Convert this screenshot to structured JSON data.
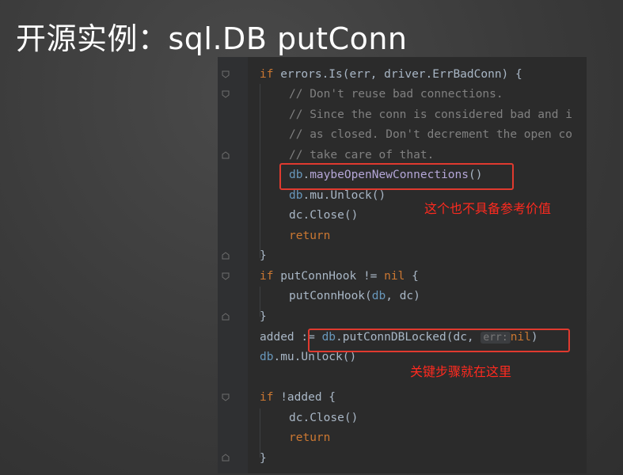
{
  "slide": {
    "title": "开源实例：sql.DB putConn"
  },
  "annotations": {
    "first": "这个也不具备参考价值",
    "second": "关键步骤就在这里"
  },
  "code": {
    "l1": {
      "kw": "if",
      "a": " errors.Is(err, driver.ErrBadConn) {"
    },
    "l2": "// Don't reuse bad connections.",
    "l3": "// Since the conn is considered bad and i",
    "l4": "// as closed. Don't decrement the open co",
    "l5": "// take care of that.",
    "l6": {
      "obj": "db",
      "dot": ".",
      "call": "maybeOpenNewConnections",
      "end": "()"
    },
    "l7": {
      "obj": "db",
      "rest": ".mu.",
      "call": "Unlock",
      "end": "()"
    },
    "l8": {
      "obj": "dc.",
      "call": "Close",
      "end": "()"
    },
    "l9": "return",
    "l10": "}",
    "l11": {
      "kw": "if",
      "a": " putConnHook != ",
      "nil": "nil",
      "b": " {"
    },
    "l12": {
      "a": "putConnHook(",
      "obj": "db",
      "b": ", dc)"
    },
    "l13": "}",
    "l14": {
      "a": "added := ",
      "obj": "db",
      "dot": ".",
      "call": "putConnDBLocked",
      "b": "(dc, ",
      "hint": "err:",
      "nil": "nil",
      "end": ")"
    },
    "l15": {
      "obj": "db",
      "rest": ".mu.",
      "call": "Unlock",
      "end": "()"
    },
    "l17": {
      "kw": "if",
      "a": " !added {"
    },
    "l18": {
      "obj": "dc.",
      "call": "Close",
      "end": "()"
    },
    "l19": "return",
    "l20": "}"
  },
  "colors": {
    "keyword": "#cc7832",
    "comment": "#808080",
    "annotation": "#ff2a1f",
    "editor_bg": "#2b2b2b"
  }
}
